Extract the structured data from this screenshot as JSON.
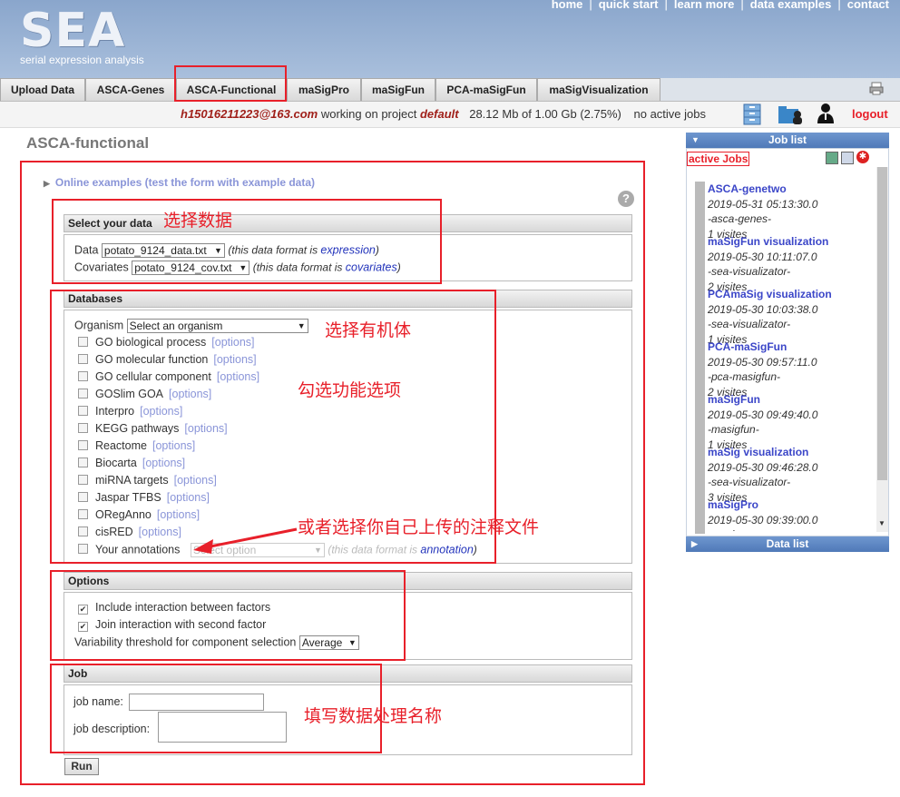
{
  "header": {
    "logo": "SEA",
    "logo_sub": "serial expression analysis",
    "nav": [
      "home",
      "quick start",
      "learn more",
      "data examples",
      "contact"
    ]
  },
  "tabs": [
    "Upload Data",
    "ASCA-Genes",
    "ASCA-Functional",
    "maSigPro",
    "maSigFun",
    "PCA-maSigFun",
    "maSigVisualization"
  ],
  "status": {
    "user": "h15016211223@163.com",
    "working_text": "working on project",
    "project": "default",
    "usage": "28.12 Mb of 1.00 Gb (2.75%)",
    "jobs": "no active jobs",
    "logout": "logout"
  },
  "page": {
    "title": "ASCA-functional",
    "online_examples": "Online examples (test the form with example data)"
  },
  "select_data": {
    "heading": "Select your data",
    "data_label": "Data",
    "data_value": "potato_9124_data.txt",
    "data_hint": "(this data format is ",
    "data_link": "expression",
    "cov_label": "Covariates",
    "cov_value": "potato_9124_cov.txt",
    "cov_hint": "(this data format is ",
    "cov_link": "covariates",
    "close": ")"
  },
  "databases": {
    "heading": "Databases",
    "organism_label": "Organism",
    "organism_value": "Select an organism",
    "options_label": "[options]",
    "items": [
      "GO biological process",
      "GO molecular function",
      "GO cellular component",
      "GOSlim GOA",
      "Interpro",
      "KEGG pathways",
      "Reactome",
      "Biocarta",
      "miRNA targets",
      "Jaspar TFBS",
      "ORegAnno",
      "cisRED"
    ],
    "your_annotations": "Your annotations",
    "annot_select": "Select option",
    "annot_hint": "(this data format is ",
    "annot_link": "annotation",
    "close": ")"
  },
  "options": {
    "heading": "Options",
    "include_interaction": "Include interaction between factors",
    "join_interaction": "Join interaction with second factor",
    "threshold_label": "Variability threshold for component selection",
    "threshold_value": "Average"
  },
  "job": {
    "heading": "Job",
    "name_label": "job name:",
    "desc_label": "job description:",
    "run": "Run"
  },
  "annotations": {
    "select_data": "选择数据",
    "organism": "选择有机体",
    "functions": "勾选功能选项",
    "own_annotation": "或者选择你自己上传的注释文件",
    "job_name": "填写数据处理名称"
  },
  "joblist": {
    "heading": "Job list",
    "active": "active Jobs",
    "data_list": "Data list",
    "jobs": [
      {
        "title": "ASCA-genetwo",
        "date": "2019-05-31 05:13:30.0",
        "type": "-asca-genes-",
        "visits": "1 visites"
      },
      {
        "title": "maSigFun visualization",
        "date": "2019-05-30 10:11:07.0",
        "type": "-sea-visualizator-",
        "visits": "2 visites"
      },
      {
        "title": "PCAmaSig visualization",
        "date": "2019-05-30 10:03:38.0",
        "type": "-sea-visualizator-",
        "visits": "1 visites"
      },
      {
        "title": "PCA-maSigFun",
        "date": "2019-05-30 09:57:11.0",
        "type": "-pca-masigfun-",
        "visits": "2 visites"
      },
      {
        "title": "maSigFun",
        "date": "2019-05-30 09:49:40.0",
        "type": "-masigfun-",
        "visits": "1 visites"
      },
      {
        "title": "maSig visualization",
        "date": "2019-05-30 09:46:28.0",
        "type": "-sea-visualizator-",
        "visits": "3 visites"
      },
      {
        "title": "maSigPro",
        "date": "2019-05-30 09:39:00.0",
        "type": "-masigpro-",
        "visits": ""
      }
    ]
  },
  "colors": {
    "accent_red": "#e8202a",
    "header_blue": "#8aa6cc",
    "link_blue": "#3b46c8"
  }
}
